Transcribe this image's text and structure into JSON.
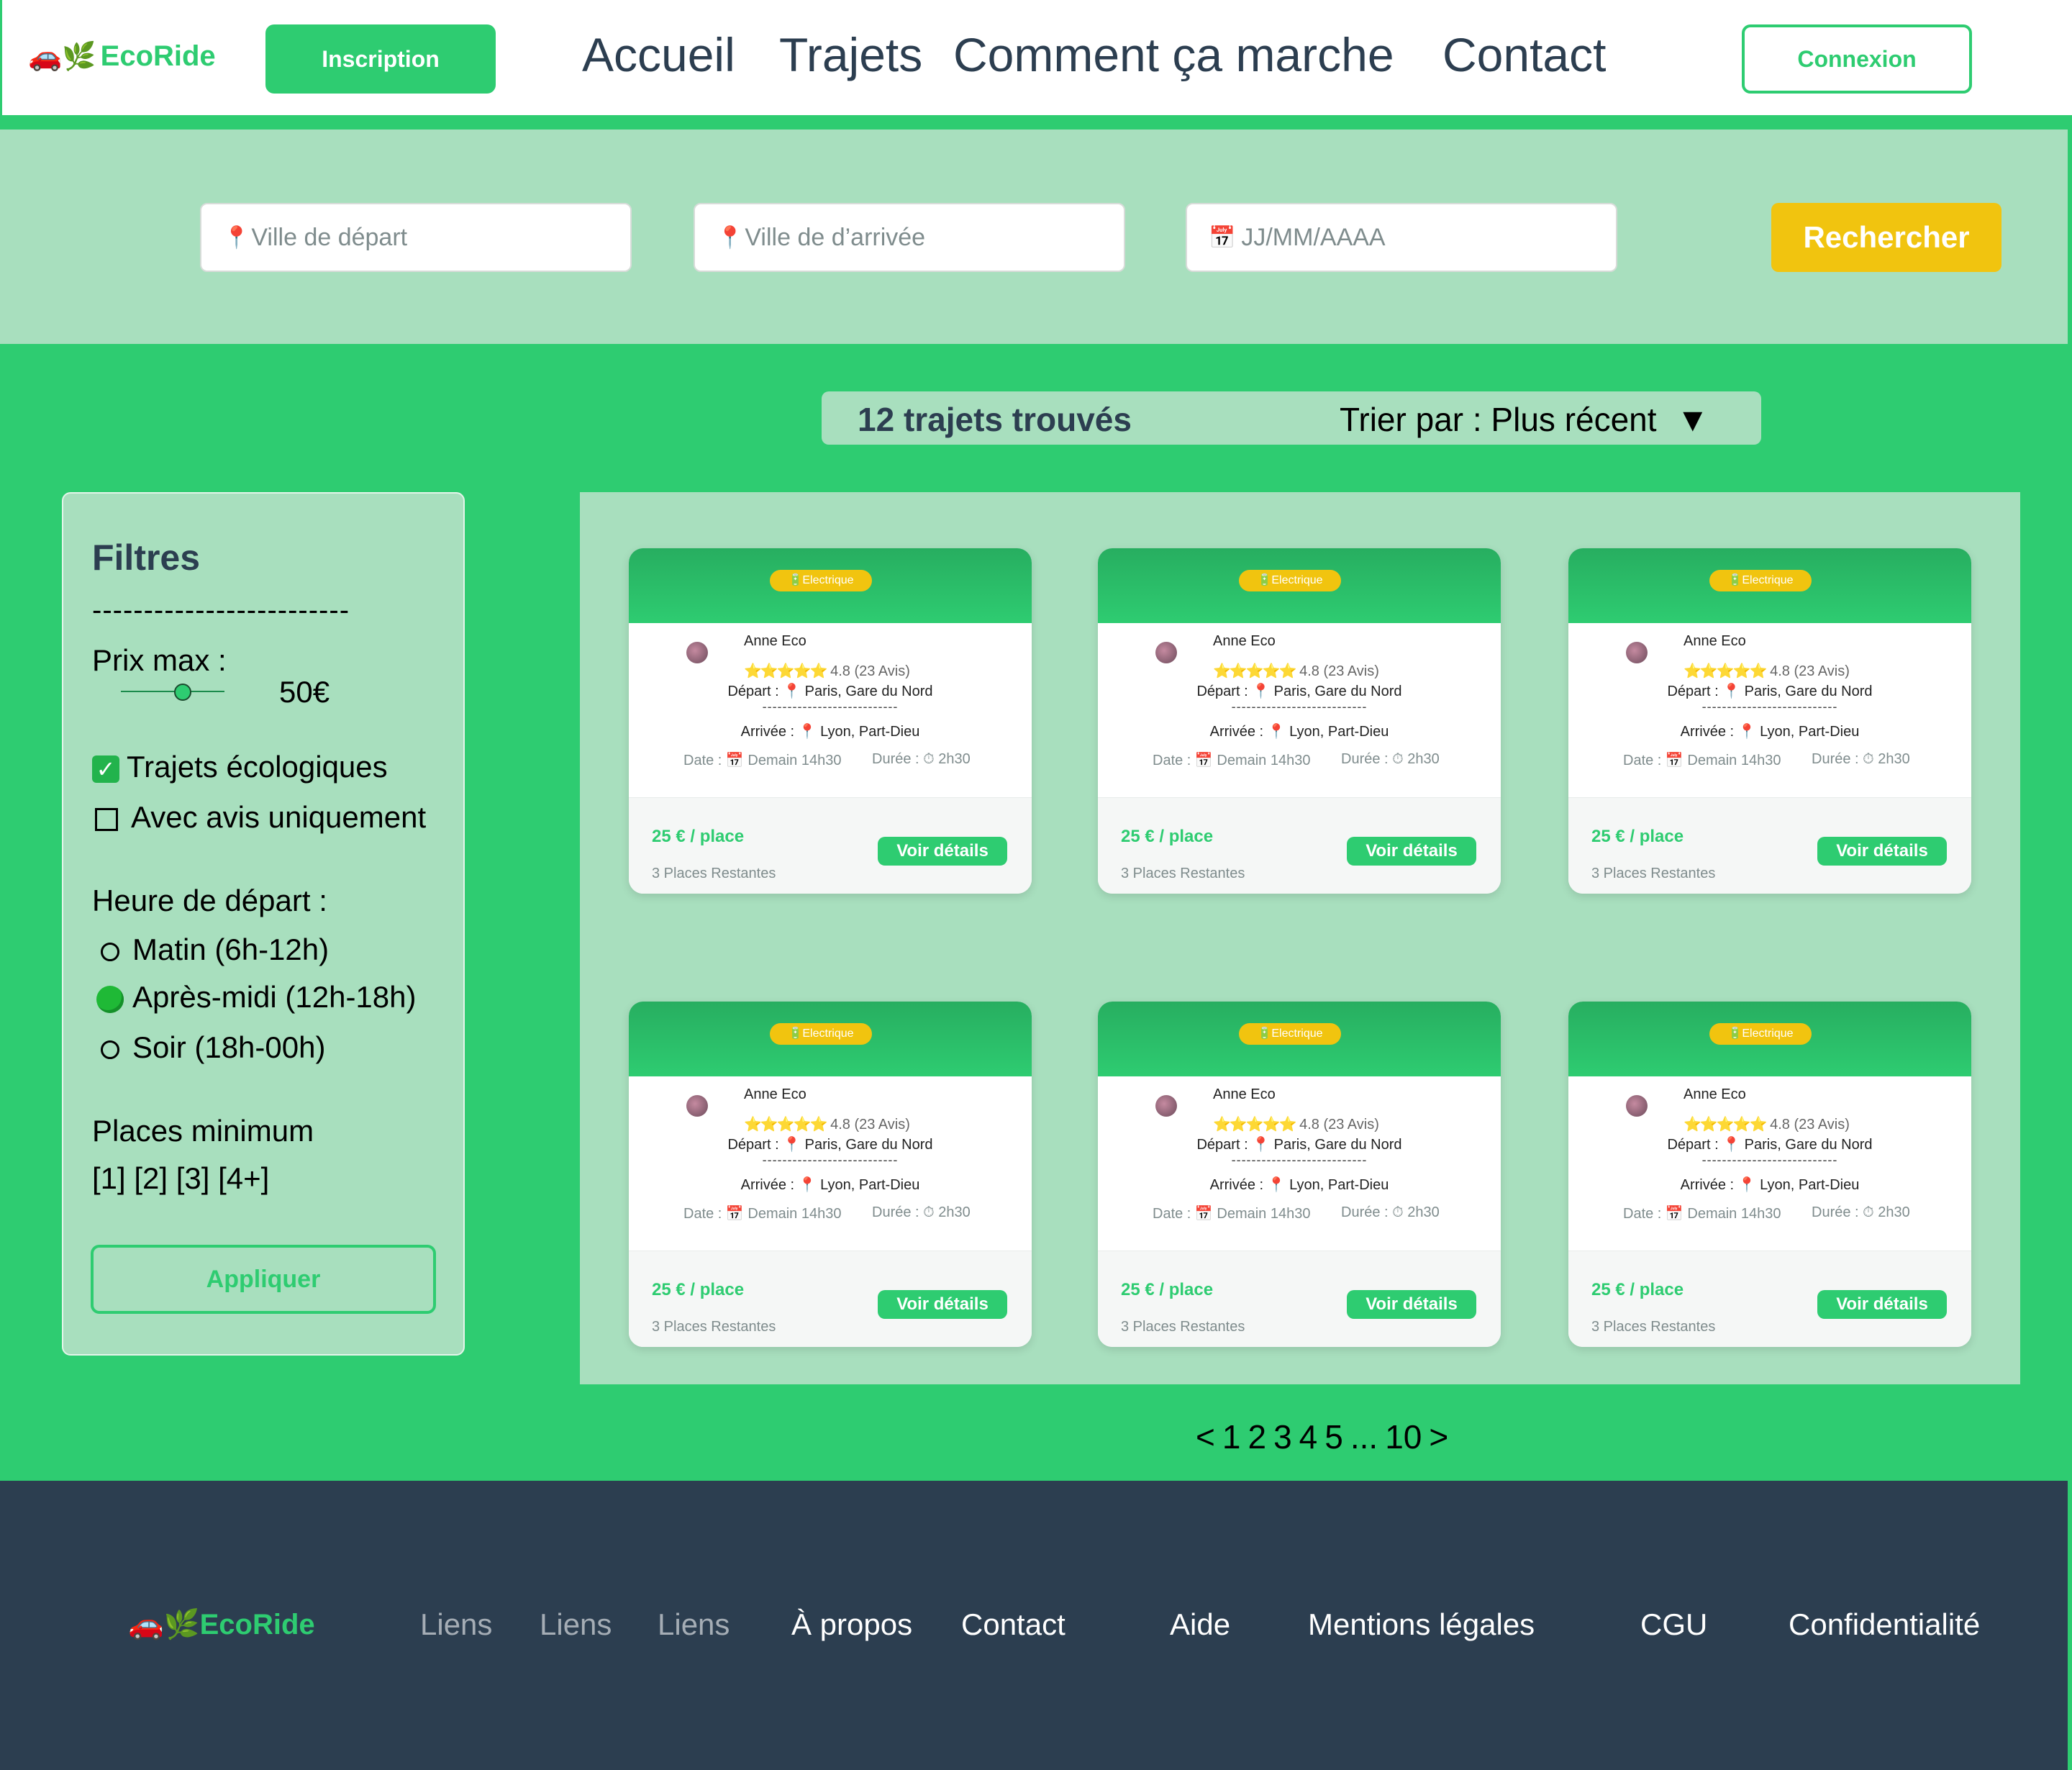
{
  "header": {
    "logo_icon": "🚗🌿",
    "logo_text": "EcoRide",
    "signup": "Inscription",
    "nav": [
      "Accueil",
      "Trajets",
      "Comment ça marche",
      "Contact"
    ],
    "login": "Connexion"
  },
  "search": {
    "departure_placeholder": "Ville de départ",
    "arrival_placeholder": "Ville de d’arrivée",
    "date_placeholder": "JJ/MM/AAAA",
    "pin_icon": "📍",
    "calendar_icon": "📅",
    "button": "Rechercher"
  },
  "results": {
    "count": "12 trajets trouvés",
    "sort": "Trier par : Plus récent",
    "sort_arrow": "▼"
  },
  "filters": {
    "title": "Filtres",
    "separator": "-------------------------",
    "price_label": "Prix max :",
    "price_value": "50€",
    "price_fraction": 0.6,
    "eco_label": "Trajets écologiques",
    "eco_checked": true,
    "reviews_label": "Avec avis uniquement",
    "reviews_checked": false,
    "time_label": "Heure de départ :",
    "times": [
      {
        "label": "Matin (6h-12h)",
        "selected": false
      },
      {
        "label": "Après-midi (12h-18h)",
        "selected": true
      },
      {
        "label": "Soir (18h-00h)",
        "selected": false
      }
    ],
    "seats_label": "Places minimum",
    "seats_options": "[1] [2] [3] [4+]",
    "apply": "Appliquer"
  },
  "cards": [
    {
      "badge": "🔋Electrique",
      "driver": "Anne Eco",
      "stars": "⭐⭐⭐⭐⭐",
      "rating": "4.8 (23 Avis)",
      "departure": "Départ : 📍 Paris, Gare du Nord",
      "separator": "---------------------------",
      "arrival": "Arrivée : 📍 Lyon, Part-Dieu",
      "date": "Date : 📅 Demain 14h30",
      "duration": "Durée : ⏱ 2h30",
      "price": "25 € / place",
      "seats": "3 Places Restantes",
      "details": "Voir détails"
    },
    {
      "badge": "🔋Electrique",
      "driver": "Anne Eco",
      "stars": "⭐⭐⭐⭐⭐",
      "rating": "4.8 (23 Avis)",
      "departure": "Départ : 📍 Paris, Gare du Nord",
      "separator": "---------------------------",
      "arrival": "Arrivée : 📍 Lyon, Part-Dieu",
      "date": "Date : 📅 Demain 14h30",
      "duration": "Durée : ⏱ 2h30",
      "price": "25 € / place",
      "seats": "3 Places Restantes",
      "details": "Voir détails"
    },
    {
      "badge": "🔋Electrique",
      "driver": "Anne Eco",
      "stars": "⭐⭐⭐⭐⭐",
      "rating": "4.8 (23 Avis)",
      "departure": "Départ : 📍 Paris, Gare du Nord",
      "separator": "---------------------------",
      "arrival": "Arrivée : 📍 Lyon, Part-Dieu",
      "date": "Date : 📅 Demain 14h30",
      "duration": "Durée : ⏱ 2h30",
      "price": "25 € / place",
      "seats": "3 Places Restantes",
      "details": "Voir détails"
    },
    {
      "badge": "🔋Electrique",
      "driver": "Anne Eco",
      "stars": "⭐⭐⭐⭐⭐",
      "rating": "4.8 (23 Avis)",
      "departure": "Départ : 📍 Paris, Gare du Nord",
      "separator": "---------------------------",
      "arrival": "Arrivée : 📍 Lyon, Part-Dieu",
      "date": "Date : 📅 Demain 14h30",
      "duration": "Durée : ⏱ 2h30",
      "price": "25 € / place",
      "seats": "3 Places Restantes",
      "details": "Voir détails"
    },
    {
      "badge": "🔋Electrique",
      "driver": "Anne Eco",
      "stars": "⭐⭐⭐⭐⭐",
      "rating": "4.8 (23 Avis)",
      "departure": "Départ : 📍 Paris, Gare du Nord",
      "separator": "---------------------------",
      "arrival": "Arrivée : 📍 Lyon, Part-Dieu",
      "date": "Date : 📅 Demain 14h30",
      "duration": "Durée : ⏱ 2h30",
      "price": "25 € / place",
      "seats": "3 Places Restantes",
      "details": "Voir détails"
    },
    {
      "badge": "🔋Electrique",
      "driver": "Anne Eco",
      "stars": "⭐⭐⭐⭐⭐",
      "rating": "4.8 (23 Avis)",
      "departure": "Départ : 📍 Paris, Gare du Nord",
      "separator": "---------------------------",
      "arrival": "Arrivée : 📍 Lyon, Part-Dieu",
      "date": "Date : 📅 Demain 14h30",
      "duration": "Durée : ⏱ 2h30",
      "price": "25 € / place",
      "seats": "3 Places Restantes",
      "details": "Voir détails"
    }
  ],
  "pagination": [
    "<",
    "1",
    "2",
    "3",
    "4",
    "5",
    "...",
    "10",
    ">"
  ],
  "footer": {
    "logo_icon": "🚗🌿",
    "logo_text": "EcoRide",
    "links": [
      "Liens",
      "Liens",
      "Liens",
      "À propos",
      "Contact",
      "Aide",
      "Mentions légales",
      "CGU",
      "Confidentialité"
    ]
  },
  "colors": {
    "brand_green": "#2ecc71",
    "light_green": "#a8dfbe",
    "accent_yellow": "#f1c40f",
    "dark_navy": "#2c3e50"
  }
}
